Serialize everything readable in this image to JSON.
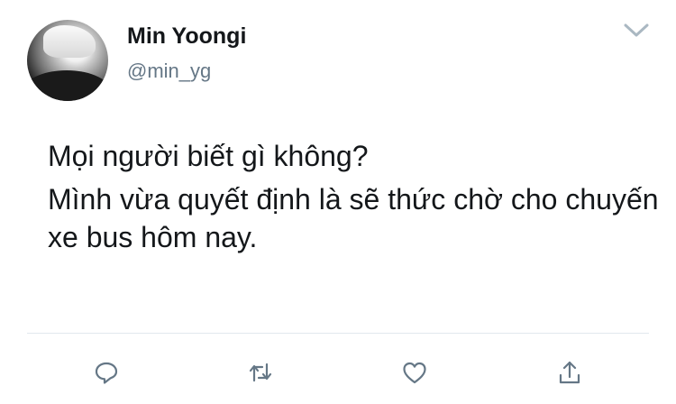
{
  "tweet": {
    "author": {
      "display_name": "Min Yoongi",
      "handle": "@min_yg",
      "avatar": "profile-photo"
    },
    "text": {
      "line1": "Mọi người biết gì không?",
      "line2": "Mình vừa quyết định là sẽ thức chờ cho chuyến xe bus hôm nay."
    },
    "menu_icon": "chevron-down-icon",
    "actions": [
      {
        "name": "reply",
        "icon": "reply-icon"
      },
      {
        "name": "retweet",
        "icon": "retweet-icon"
      },
      {
        "name": "like",
        "icon": "heart-icon"
      },
      {
        "name": "share",
        "icon": "share-icon"
      }
    ],
    "colors": {
      "text": "#14171a",
      "secondary": "#657786",
      "divider": "#e1e8ed",
      "icon": "#657786"
    }
  }
}
